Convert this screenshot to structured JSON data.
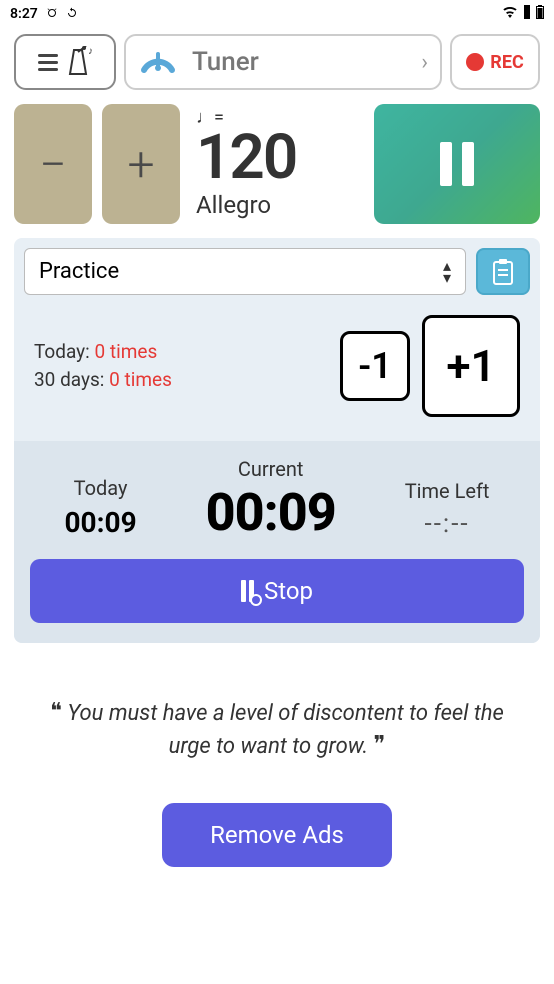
{
  "status": {
    "time": "8:27",
    "alarm_icon": "⏰",
    "sync_icon": "⟳",
    "wifi_icon": "▾",
    "signal_icon": "▮",
    "battery_icon": "▯"
  },
  "topbar": {
    "tuner_label": "Tuner",
    "rec_label": "REC"
  },
  "tempo": {
    "minus": "−",
    "plus": "+",
    "note_marking": "♩=",
    "bpm": "120",
    "name": "Allegro"
  },
  "practice": {
    "select_label": "Practice",
    "today_label": "Today:",
    "today_count": "0 times",
    "days30_label": "30 days:",
    "days30_count": "0 times",
    "minus_label": "-1",
    "plus_label": "+1"
  },
  "timer": {
    "today_label": "Today",
    "today_time": "00:09",
    "current_label": "Current",
    "current_time": "00:09",
    "left_label": "Time Left",
    "left_time": "--:--",
    "stop_label": "Stop"
  },
  "quote": {
    "text": "You must have a level of discontent to feel the urge to want to grow."
  },
  "ads": {
    "remove_label": "Remove Ads"
  }
}
